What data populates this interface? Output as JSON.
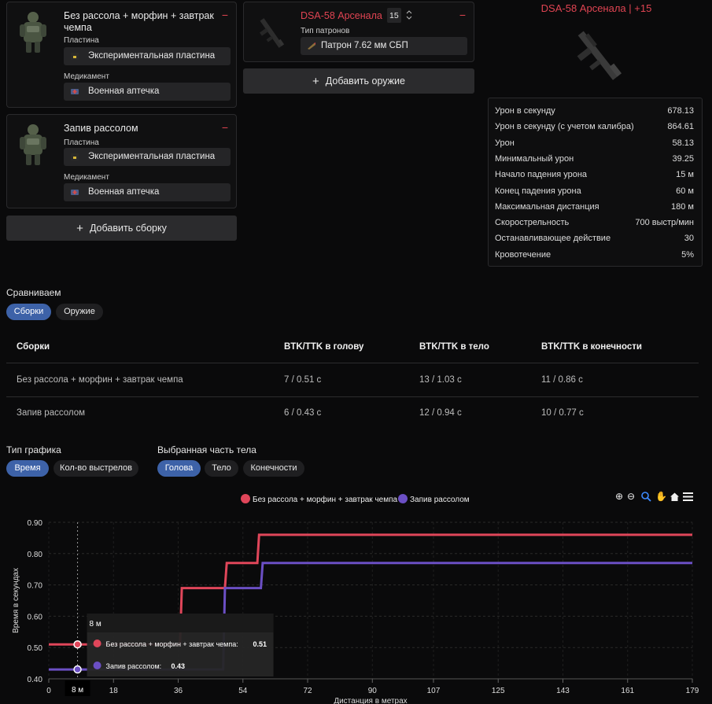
{
  "builds": [
    {
      "title": "Без рассола + морфин + завтрак чемпа",
      "plate_label": "Пластина",
      "plate_value": "Экспериментальная пластина",
      "med_label": "Медикамент",
      "med_value": "Военная аптечка",
      "remove_glyph": "−"
    },
    {
      "title": "Запив рассолом",
      "plate_label": "Пластина",
      "plate_value": "Экспериментальная пластина",
      "med_label": "Медикамент",
      "med_value": "Военная аптечка",
      "remove_glyph": "−"
    }
  ],
  "add_build_label": "Добавить сборку",
  "weapon": {
    "name": "DSA-58 Арсенала",
    "level": "15",
    "ammo_label": "Тип патронов",
    "ammo_value": "Патрон 7.62 мм СБП",
    "remove_glyph": "−",
    "name_color": "#e04452"
  },
  "add_weapon_label": "Добавить оружие",
  "preview": {
    "title": "DSA-58 Арсенала | +15"
  },
  "stats": [
    {
      "label": "Урон в секунду",
      "value": "678.13"
    },
    {
      "label": "Урон в секунду (с учетом калибра)",
      "value": "864.61"
    },
    {
      "label": "Урон",
      "value": "58.13"
    },
    {
      "label": "Минимальный урон",
      "value": "39.25"
    },
    {
      "label": "Начало падения урона",
      "value": "15 м"
    },
    {
      "label": "Конец падения урона",
      "value": "60 м"
    },
    {
      "label": "Максимальная дистанция",
      "value": "180 м"
    },
    {
      "label": "Скорострельность",
      "value": "700 выстр/мин"
    },
    {
      "label": "Останавливающее действие",
      "value": "30"
    },
    {
      "label": "Кровотечение",
      "value": "5%"
    }
  ],
  "compare": {
    "label": "Сравниваем",
    "tabs": [
      "Сборки",
      "Оружие"
    ],
    "active": 0
  },
  "table": {
    "headers": [
      "Сборки",
      "BTK/TTK в голову",
      "BTK/TTK в тело",
      "BTK/TTK в конечности"
    ],
    "rows": [
      [
        "Без рассола + морфин + завтрак чемпа",
        "7 / 0.51 с",
        "13 / 1.03 с",
        "11 / 0.86 с"
      ],
      [
        "Запив рассолом",
        "6 / 0.43 с",
        "12 / 0.94 с",
        "10 / 0.77 с"
      ]
    ]
  },
  "chart_type": {
    "label": "Тип графика",
    "options": [
      "Время",
      "Кол-во выстрелов"
    ],
    "active": 0
  },
  "body_part": {
    "label": "Выбранная часть тела",
    "options": [
      "Голова",
      "Тело",
      "Конечности"
    ],
    "active": 0
  },
  "colors": {
    "series1": "#e0465a",
    "series2": "#6b4fc4",
    "accent": "#3d62a8",
    "danger": "#e04452"
  },
  "toolbar_icons": [
    "zoom-in-icon",
    "zoom-out-icon",
    "zoom-select-icon",
    "pan-hand-icon",
    "home-icon",
    "menu-icon"
  ],
  "chart_data": {
    "type": "line",
    "xlabel": "Дистанция в метрах",
    "ylabel": "Время в секундах",
    "xlim": [
      0,
      179
    ],
    "ylim": [
      0.4,
      0.9
    ],
    "x_ticks": [
      "0",
      "18",
      "36",
      "54",
      "72",
      "90",
      "107",
      "125",
      "143",
      "161",
      "179"
    ],
    "x_tick_values": [
      0,
      18,
      36,
      54,
      72,
      90,
      107,
      125,
      143,
      161,
      179
    ],
    "y_ticks": [
      "0.40",
      "0.50",
      "0.60",
      "0.70",
      "0.80",
      "0.90"
    ],
    "y_tick_values": [
      0.4,
      0.5,
      0.6,
      0.7,
      0.8,
      0.9
    ],
    "legend_position": "top-center",
    "series": [
      {
        "name": "Без рассола + морфин + завтрак чемпа",
        "color": "#e0465a",
        "points": [
          [
            0,
            0.51
          ],
          [
            15,
            0.51
          ],
          [
            36.5,
            0.51
          ],
          [
            37,
            0.69
          ],
          [
            49,
            0.69
          ],
          [
            49.5,
            0.77
          ],
          [
            58,
            0.77
          ],
          [
            58.5,
            0.86
          ],
          [
            179,
            0.86
          ]
        ]
      },
      {
        "name": "Запив рассолом",
        "color": "#6b4fc4",
        "points": [
          [
            0,
            0.43
          ],
          [
            15,
            0.43
          ],
          [
            48.5,
            0.43
          ],
          [
            49,
            0.69
          ],
          [
            59,
            0.69
          ],
          [
            59.5,
            0.77
          ],
          [
            179,
            0.77
          ]
        ]
      }
    ],
    "crosshair": {
      "x_label": "8 м",
      "x": 8
    },
    "tooltip": {
      "title": "8 м",
      "items": [
        {
          "name": "Без рассола + морфин + завтрак чемпа:",
          "value": "0.51"
        },
        {
          "name": "Запив рассолом:",
          "value": "0.43"
        }
      ]
    }
  }
}
